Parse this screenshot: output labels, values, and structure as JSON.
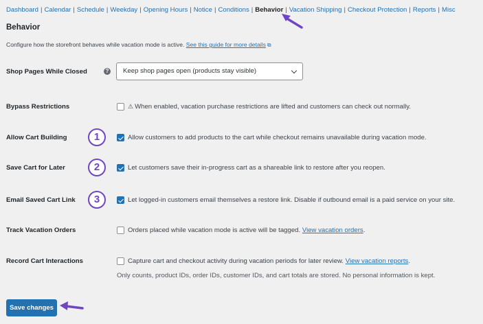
{
  "nav": {
    "items": [
      {
        "label": "Dashboard"
      },
      {
        "label": "Calendar"
      },
      {
        "label": "Schedule"
      },
      {
        "label": "Weekday"
      },
      {
        "label": "Opening Hours"
      },
      {
        "label": "Notice"
      },
      {
        "label": "Conditions"
      },
      {
        "label": "Behavior",
        "active": true
      },
      {
        "label": "Vacation Shipping"
      },
      {
        "label": "Checkout Protection"
      },
      {
        "label": "Reports"
      },
      {
        "label": "Misc"
      }
    ]
  },
  "page": {
    "title": "Behavior",
    "description": "Configure how the storefront behaves while vacation mode is active.",
    "guide_link": "See this guide for more details"
  },
  "settings": {
    "shop_pages": {
      "label": "Shop Pages While Closed",
      "help_icon": "?",
      "selected": "Keep shop pages open (products stay visible)"
    },
    "bypass": {
      "label": "Bypass Restrictions",
      "checked": false,
      "warning_icon": "⚠",
      "text": "When enabled, vacation purchase restrictions are lifted and customers can check out normally."
    },
    "allow_cart": {
      "label": "Allow Cart Building",
      "checked": true,
      "text": "Allow customers to add products to the cart while checkout remains unavailable during vacation mode."
    },
    "save_cart": {
      "label": "Save Cart for Later",
      "checked": true,
      "text": "Let customers save their in-progress cart as a shareable link to restore after you reopen."
    },
    "email_cart": {
      "label": "Email Saved Cart Link",
      "checked": true,
      "text": "Let logged-in customers email themselves a restore link. Disable if outbound email is a paid service on your site."
    },
    "track_orders": {
      "label": "Track Vacation Orders",
      "checked": false,
      "text": "Orders placed while vacation mode is active will be tagged.",
      "link": "View vacation orders",
      "suffix": "."
    },
    "record_cart": {
      "label": "Record Cart Interactions",
      "checked": false,
      "text": "Capture cart and checkout activity during vacation periods for later review.",
      "link": "View vacation reports",
      "suffix": ".",
      "note": "Only counts, product IDs, order IDs, customer IDs, and cart totals are stored. No personal information is kept."
    }
  },
  "annotations": {
    "badges": [
      "1",
      "2",
      "3"
    ],
    "color": "#6f45c4"
  },
  "actions": {
    "save_label": "Save changes"
  },
  "colors": {
    "accent": "#2271b1",
    "background": "#f0f0f1",
    "annotation": "#6f45c4"
  }
}
